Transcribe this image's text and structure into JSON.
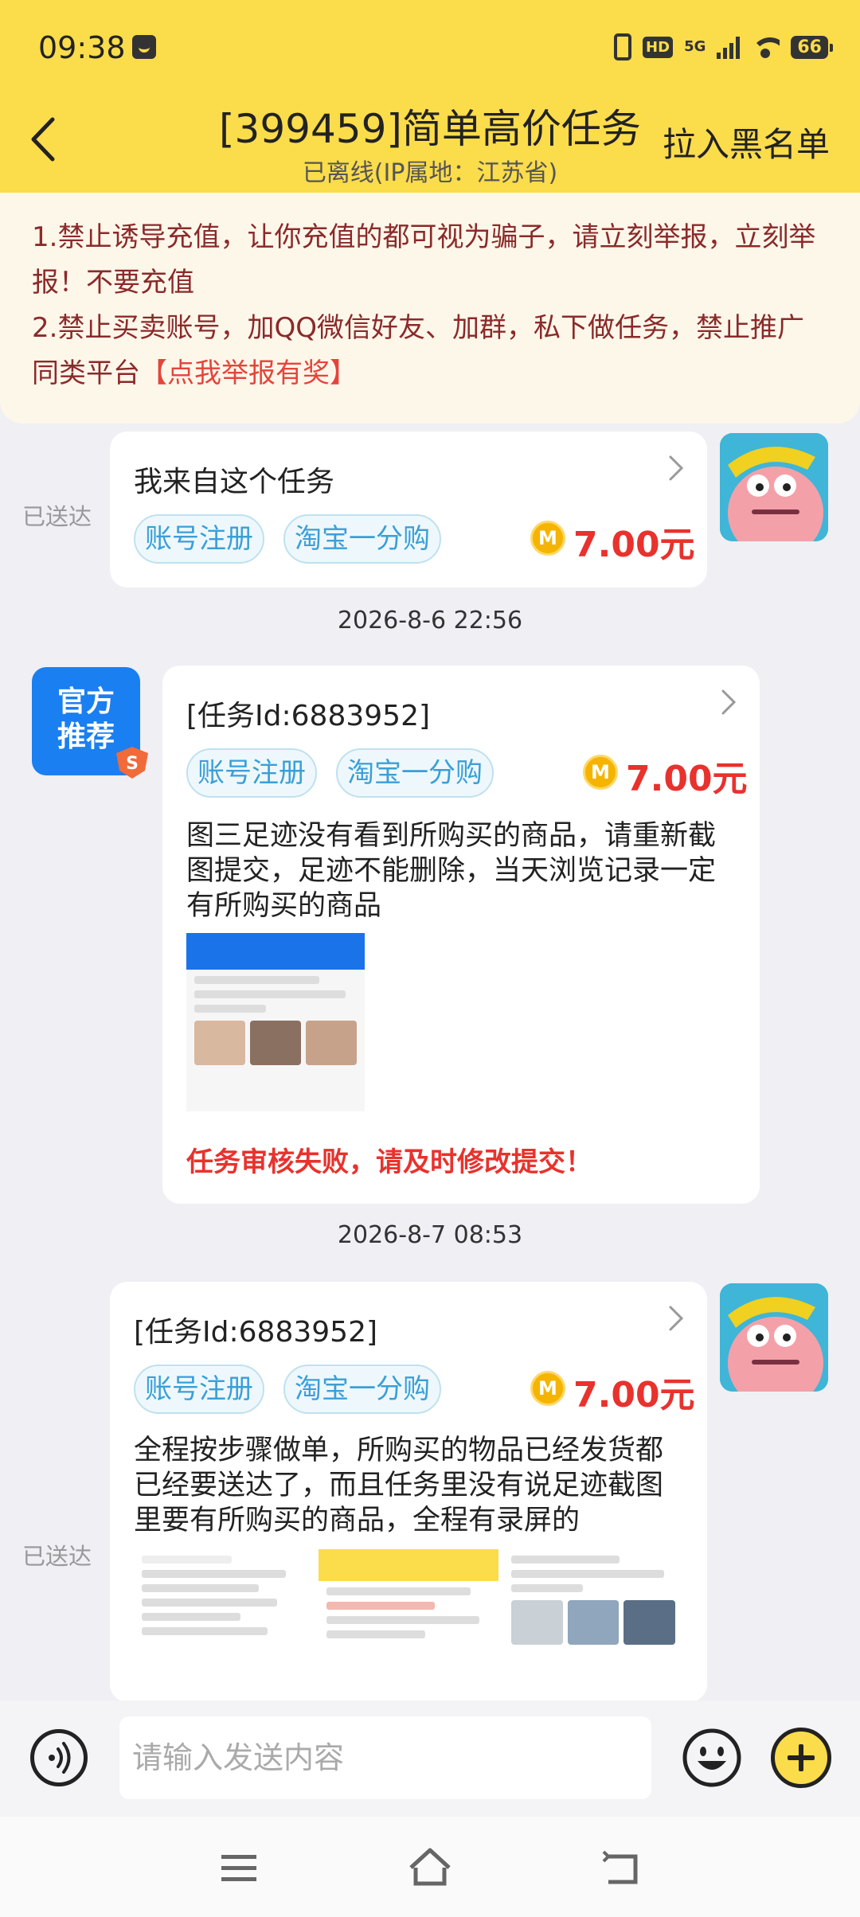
{
  "status_bar": {
    "time": "09:38",
    "hd": "HD",
    "network": "5G",
    "battery": "66"
  },
  "header": {
    "title": "[399459]简单高价任务",
    "subtitle": "已离线(IP属地：江苏省)",
    "blacklist_label": "拉入黑名单"
  },
  "notice": {
    "line1": "1.禁止诱导充值，让你充值的都可视为骗子，请立刻举报，立刻举报！不要充值",
    "line2_prefix": "2.禁止买卖账号，加QQ微信好友、加群，私下做任务，禁止推广同类平台",
    "report_link": "【点我举报有奖】"
  },
  "messages": [
    {
      "status": "已送达",
      "title": "我来自这个任务",
      "tags": [
        "账号注册",
        "淘宝一分购"
      ],
      "coin": "M",
      "price": "7.00元"
    },
    {
      "timestamp": "2026-8-6 22:56",
      "avatar_text": "官方推荐",
      "title": "[任务Id:6883952]",
      "tags": [
        "账号注册",
        "淘宝一分购"
      ],
      "coin": "M",
      "price": "7.00元",
      "text": "图三足迹没有看到所购买的商品，请重新截图提交，足迹不能删除，当天浏览记录一定有所购买的商品",
      "fail_text": "任务审核失败，请及时修改提交！"
    },
    {
      "timestamp": "2026-8-7 08:53",
      "status": "已送达",
      "title": "[任务Id:6883952]",
      "tags": [
        "账号注册",
        "淘宝一分购"
      ],
      "coin": "M",
      "price": "7.00元",
      "text": "全程按步骤做单，所购买的物品已经发货都已经要送达了，而且任务里没有说足迹截图里要有所购买的商品，全程有录屏的"
    }
  ],
  "input": {
    "placeholder": "请输入发送内容"
  },
  "colors": {
    "header_bg": "#fbdc4b",
    "price": "#e8322d",
    "tag": "#3a9fd8",
    "notice_text": "#8b2a2a"
  }
}
